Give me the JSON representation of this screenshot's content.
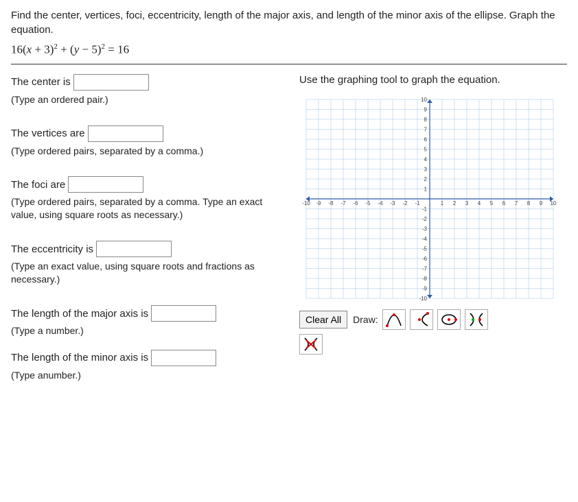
{
  "problem": {
    "text": "Find the center, vertices, foci, eccentricity, length of the major axis, and length of the minor axis of the ellipse. Graph the equation.",
    "equation_html": "16(x + 3)² + (y − 5)² = 16"
  },
  "fields": {
    "center": {
      "label_before": "The center is",
      "hint": "(Type an ordered pair.)"
    },
    "vertices": {
      "label_before": "The vertices are",
      "hint": "(Type ordered pairs, separated by a comma.)"
    },
    "foci": {
      "label_before": "The foci are",
      "hint": "(Type ordered pairs, separated by a comma. Type an exact value, using square roots as necessary.)"
    },
    "eccentricity": {
      "label_before": "The eccentricity is",
      "hint": "(Type an exact value, using square roots and fractions as necessary.)"
    },
    "major": {
      "label_before": "The length of the major axis is",
      "hint": "(Type a number.)"
    },
    "minor": {
      "label_before": "The length of the minor axis is",
      "hint": "(Type anumber.)"
    }
  },
  "graph": {
    "instruction": "Use the graphing tool to graph the equation.",
    "xmin": -10,
    "xmax": 10,
    "ymin": -10,
    "ymax": 10,
    "x_ticks": [
      -10,
      -9,
      -8,
      -7,
      -6,
      -5,
      -4,
      -3,
      -2,
      -1,
      1,
      2,
      3,
      4,
      5,
      6,
      7,
      8,
      9,
      10
    ],
    "y_ticks": [
      -10,
      -9,
      -8,
      -7,
      -6,
      -5,
      -4,
      -3,
      -2,
      -1,
      1,
      2,
      3,
      4,
      5,
      6,
      7,
      8,
      9,
      10
    ]
  },
  "toolbar": {
    "clear_all": "Clear All",
    "draw_label": "Draw:",
    "tools": {
      "parabola": "parabola-tool",
      "hyperbola_arm": "hyperbola-arm-tool",
      "ellipse": "ellipse-tool",
      "hyperbola_x": "hyperbola-x-tool",
      "delete": "delete-tool"
    }
  }
}
